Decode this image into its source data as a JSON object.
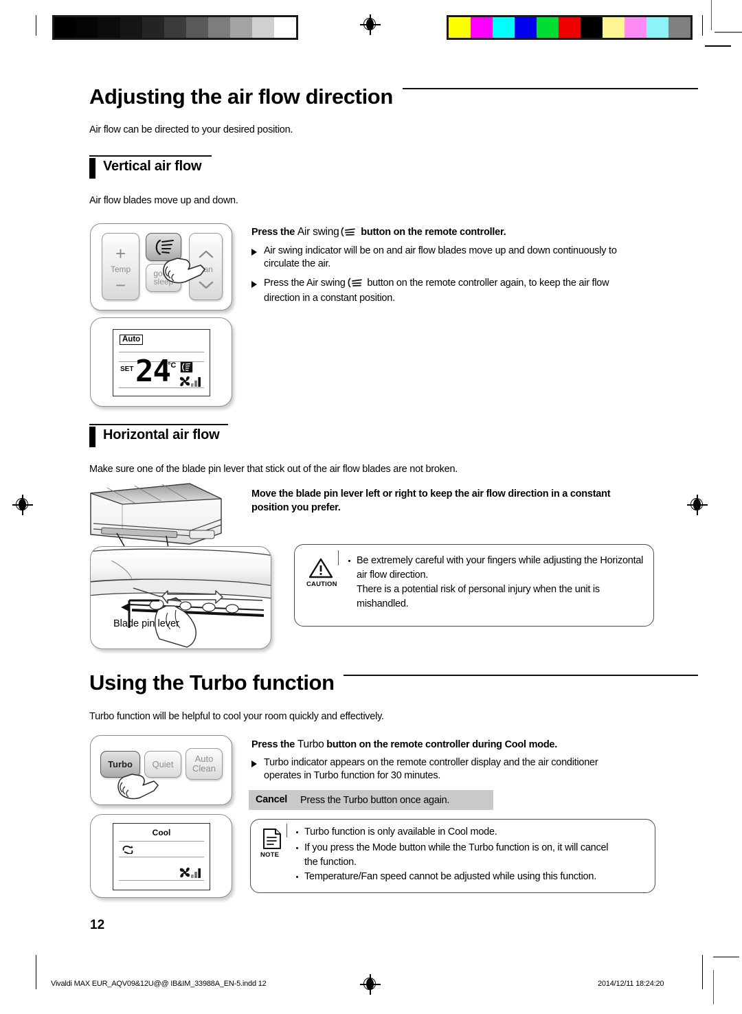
{
  "document": {
    "page_number": "12",
    "footer_file": "Vivaldi MAX EUR_AQV09&12U@@ IB&IM_33988A_EN-5.indd   12",
    "footer_page": "12",
    "footer_timestamp": "2014/12/11   18:24:20"
  },
  "calibration": {
    "grayscale": [
      "#000000",
      "#050505",
      "#0c0c0c",
      "#151515",
      "#242424",
      "#3c3c3c",
      "#5a5a5a",
      "#7d7d7d",
      "#a3a3a3",
      "#d0d0d0",
      "#ffffff"
    ],
    "color": [
      "#ffff00",
      "#ff00ff",
      "#00ffff",
      "#0000ee",
      "#00dd33",
      "#ee0000",
      "#000000",
      "#fdf592",
      "#ff8cf5",
      "#8cf3f7",
      "#808080"
    ]
  },
  "section1": {
    "title": "Adjusting the air flow direction",
    "intro": "Air flow can be directed to your desired position.",
    "sub1": {
      "title": "Vertical air flow",
      "lead": "Air flow blades move up and down.",
      "instruction_pre": "Press the ",
      "instruction_mid": "Air swing",
      "instruction_post": " button on the remote controller.",
      "bullets": [
        "Air swing indicator will be on and air flow blades move up and down continuously to circulate the air.",
        "Press the Air swing  button on the remote controller again, to keep the air flow direction in a constant position."
      ],
      "bullet2_pre": "Press the ",
      "bullet2_mid": "Air swing",
      "bullet2_post": " button on the remote controller again, to keep the air flow",
      "bullet2_line2": "direction in a constant position.",
      "bullet1_line1": "Air swing indicator will be on and air flow blades move up and down continuously to",
      "bullet1_line2": "circulate the air.",
      "remote": {
        "temp_label": "Temp",
        "plus_label": "+",
        "minus_label": "−",
        "swing_icon": "air-swing-icon",
        "goodsleep_label_1": "good’",
        "goodsleep_label_2": "sleep",
        "fan_label": "Fan",
        "fan_up_icon": "chevron-up-icon",
        "fan_down_icon": "chevron-down-icon"
      },
      "display": {
        "mode": "Auto",
        "set_label": "SET",
        "temperature": "24",
        "unit": "°C",
        "swing_indicator": "air-swing-icon",
        "fan_indicator": "fan-icon",
        "fan_bars": "fan-speed-bars"
      }
    },
    "sub2": {
      "title": "Horizontal air flow",
      "lead": "Make sure one of the blade pin lever that stick out of the air flow blades are not broken.",
      "instruction_line1": "Move the blade pin lever left or right to keep the air flow direction in a constant",
      "instruction_line2": "position you prefer.",
      "illustration_caption": "Blade pin lever",
      "caution": {
        "label": "CAUTION",
        "lines": [
          "Be extremely careful with your fingers while adjusting the Horizontal",
          "air flow direction.",
          "There is a potential risk of personal injury when the unit is",
          "mishandled."
        ]
      }
    }
  },
  "section2": {
    "title": "Using the Turbo function",
    "intro": "Turbo function will be helpful to cool your room quickly and effectively.",
    "instruction_pre": "Press the ",
    "instruction_mid": "Turbo",
    "instruction_post": " button on the remote controller during Cool mode.",
    "bullet_line1": "Turbo indicator appears on the remote controller display and the air conditioner",
    "bullet_line2": "operates in Turbo function for 30 minutes.",
    "cancel_label": "Cancel",
    "cancel_text": "Press the Turbo button once again.",
    "remote": {
      "turbo_label": "Turbo",
      "quiet_label": "Quiet",
      "autoclean_label_1": "Auto",
      "autoclean_label_2": "Clean"
    },
    "display": {
      "mode": "Cool",
      "turbo_indicator": "turbo-icon",
      "fan_indicator": "fan-icon",
      "fan_bars": "fan-speed-bars"
    },
    "note": {
      "label": "NOTE",
      "lines": [
        "Turbo function is only available in Cool mode.",
        "If you press the Mode button while the Turbo function is on, it will cancel",
        "the function.",
        "Temperature/Fan speed cannot be adjusted while using this function."
      ]
    }
  }
}
